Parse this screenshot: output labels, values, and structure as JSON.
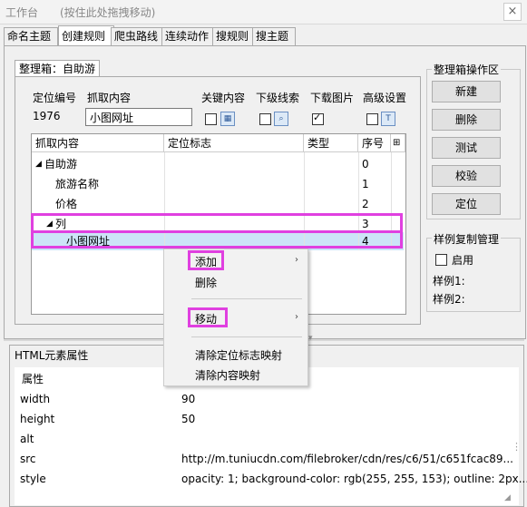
{
  "titlebar": {
    "title": "工作台",
    "hint": "(按住此处拖拽移动)",
    "close": "×"
  },
  "tabs": [
    "命名主题",
    "创建规则",
    "爬虫路线",
    "连续动作",
    "搜规则",
    "搜主题"
  ],
  "group": {
    "title": "整理箱：自助游"
  },
  "fields": {
    "locate_no_label": "定位编号",
    "locate_no_value": "1976",
    "capture_label": "抓取内容",
    "capture_value": "小图网址",
    "key_content": "关键内容",
    "sub_clue": "下级线索",
    "download_img": "下载图片",
    "advanced": "高级设置"
  },
  "grid": {
    "headers": [
      "抓取内容",
      "定位标志",
      "类型",
      "序号"
    ],
    "rows": [
      {
        "name": "自助游",
        "marker": "",
        "type": "",
        "index": "0"
      },
      {
        "name": "旅游名称",
        "marker": "",
        "type": "",
        "index": "1"
      },
      {
        "name": "价格",
        "marker": "",
        "type": "",
        "index": "2"
      },
      {
        "name": "列",
        "marker": "",
        "type": "",
        "index": "3"
      },
      {
        "name": "小图网址",
        "marker": "",
        "type": "",
        "index": "4"
      }
    ]
  },
  "actions": {
    "title": "整理箱操作区",
    "buttons": [
      "新建",
      "删除",
      "测试",
      "校验",
      "定位"
    ]
  },
  "sample": {
    "title": "样例复制管理",
    "enable": "启用",
    "s1": "样例1:",
    "s2": "样例2:"
  },
  "menu": {
    "add": "添加",
    "delete": "删除",
    "move": "移动",
    "clear_marker": "清除定位标志映射",
    "clear_content": "清除内容映射"
  },
  "properties": {
    "title": "HTML元素属性",
    "header": "属性",
    "rows": [
      {
        "key": "width",
        "value": "90"
      },
      {
        "key": "height",
        "value": "50"
      },
      {
        "key": "alt",
        "value": ""
      },
      {
        "key": "src",
        "value": "http://m.tuniucdn.com/filebroker/cdn/res/c6/51/c651fcac89..."
      },
      {
        "key": "style",
        "value": "opacity: 1; background-color: rgb(255, 255, 153); outline: 2px..."
      }
    ]
  },
  "colors": {
    "highlight": "#e040e0",
    "selection": "#cce4f7"
  }
}
